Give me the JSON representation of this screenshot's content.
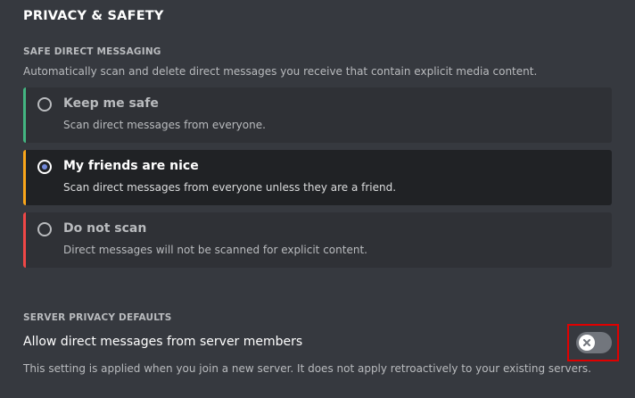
{
  "page_title": "PRIVACY & SAFETY",
  "safe_dm": {
    "label": "SAFE DIRECT MESSAGING",
    "description": "Automatically scan and delete direct messages you receive that contain explicit media content.",
    "options": [
      {
        "title": "Keep me safe",
        "description": "Scan direct messages from everyone.",
        "selected": false,
        "accent": "#43b581"
      },
      {
        "title": "My friends are nice",
        "description": "Scan direct messages from everyone unless they are a friend.",
        "selected": true,
        "accent": "#faa61a"
      },
      {
        "title": "Do not scan",
        "description": "Direct messages will not be scanned for explicit content.",
        "selected": false,
        "accent": "#f04747"
      }
    ]
  },
  "server_privacy": {
    "label": "SERVER PRIVACY DEFAULTS",
    "setting_title": "Allow direct messages from server members",
    "setting_description": "This setting is applied when you join a new server. It does not apply retroactively to your existing servers.",
    "toggle_enabled": false,
    "toggle_icon": "x-icon"
  },
  "colors": {
    "background": "#36393f",
    "option_bg": "#2f3136",
    "option_selected_bg": "#202225",
    "radio_dot": "#7289da",
    "highlight": "#e00000"
  }
}
